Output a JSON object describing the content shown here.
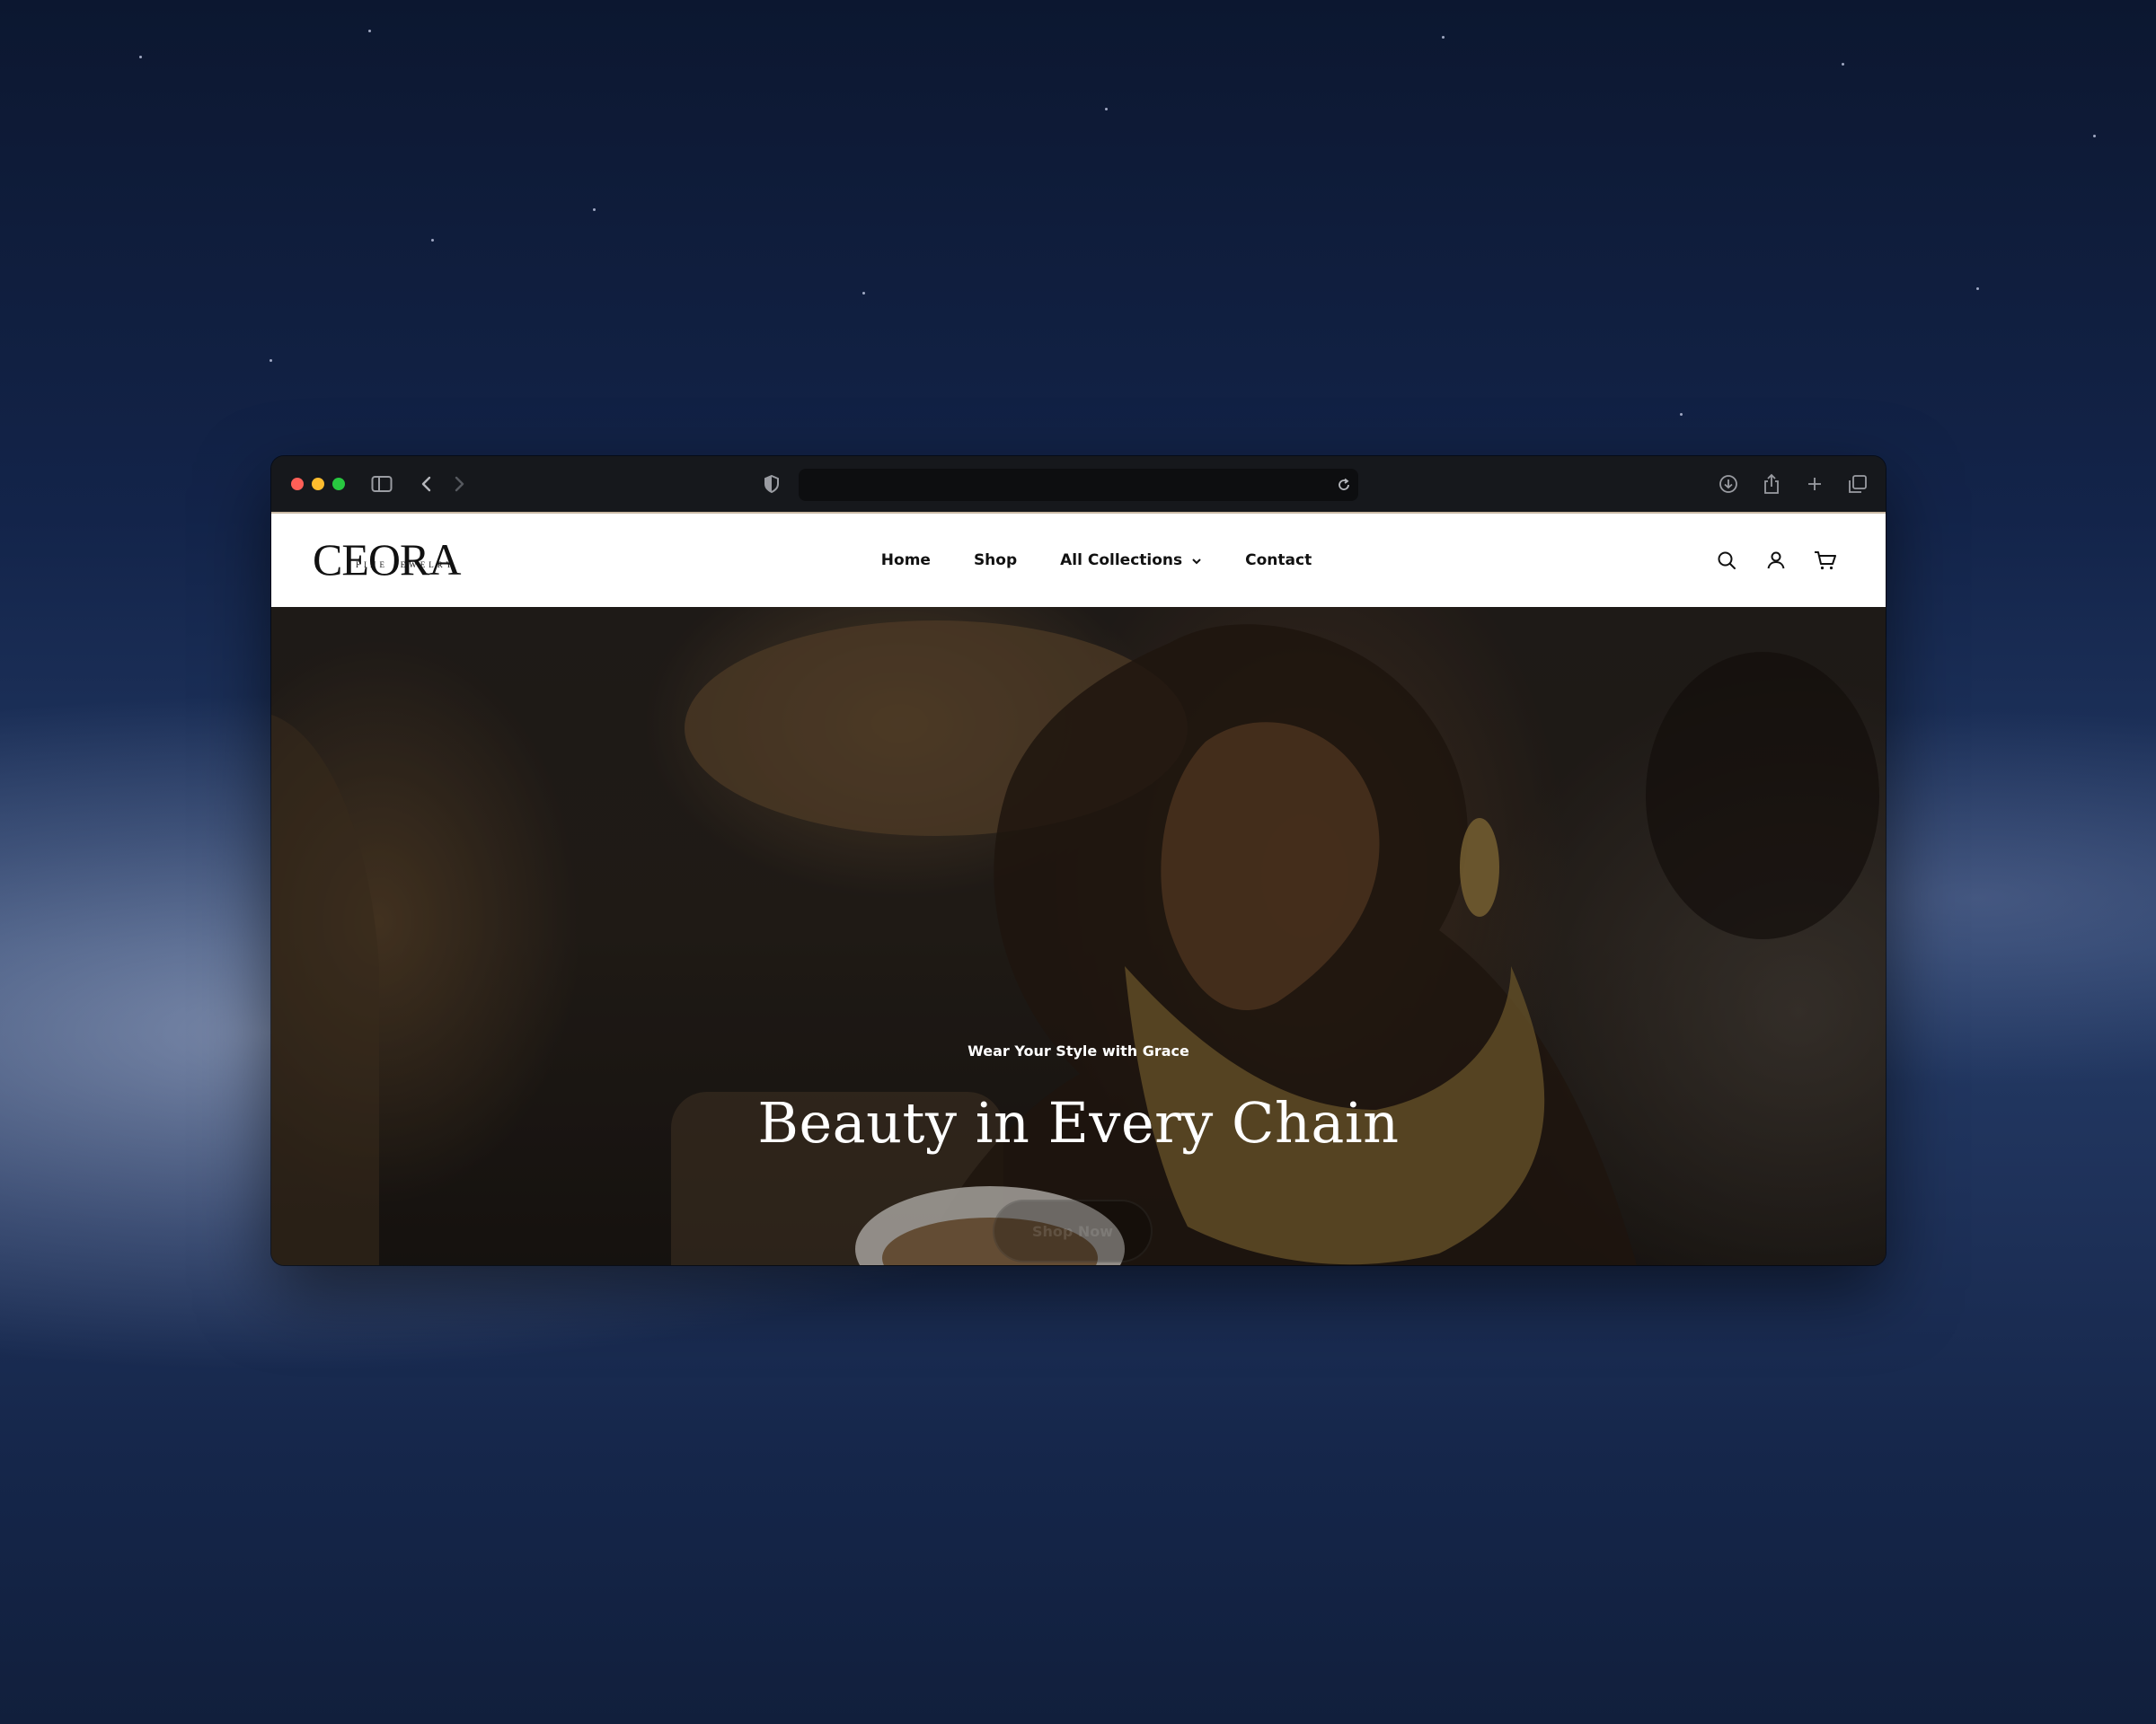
{
  "browser": {
    "traffic_lights": {
      "close": "#ff5f57",
      "minimize": "#febc2e",
      "zoom": "#28c840"
    },
    "url": ""
  },
  "site": {
    "logo": {
      "wordmark": "CEORA",
      "tagline": "FINE JEWELRY"
    },
    "nav": [
      {
        "label": "Home"
      },
      {
        "label": "Shop"
      },
      {
        "label": "All Collections",
        "has_dropdown": true
      },
      {
        "label": "Contact"
      }
    ],
    "header_icons": [
      "search-icon",
      "account-icon",
      "cart-icon"
    ]
  },
  "hero": {
    "subtitle": "Wear Your Style with Grace",
    "title": "Beauty in Every Chain",
    "button_label": "Shop Now"
  },
  "colors": {
    "header_bg": "#ffffff",
    "toolbar_bg": "#16181c",
    "text_dark": "#111111",
    "hero_text": "#ffffff"
  }
}
